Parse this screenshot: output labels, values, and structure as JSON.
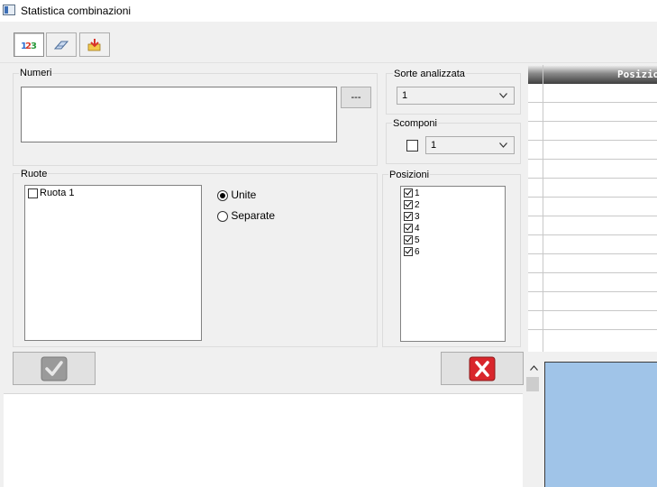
{
  "window": {
    "title": "Statistica combinazioni"
  },
  "toolbar": {
    "buttons": [
      {
        "name": "numbers-icon",
        "pressed": true
      },
      {
        "name": "eraser-icon",
        "pressed": false
      },
      {
        "name": "import-icon",
        "pressed": false
      }
    ]
  },
  "numeri": {
    "label": "Numeri",
    "value": "",
    "browse_label": "---"
  },
  "sorte": {
    "label": "Sorte analizzata",
    "selected": "1"
  },
  "scomponi": {
    "label": "Scomponi",
    "checked": false,
    "selected": "1"
  },
  "ruote": {
    "label": "Ruote",
    "items": [
      {
        "label": "Ruota 1",
        "checked": false
      }
    ],
    "modes": [
      {
        "label": "Unite",
        "selected": true
      },
      {
        "label": "Separate",
        "selected": false
      }
    ]
  },
  "posizioni": {
    "label": "Posizioni",
    "items": [
      {
        "label": "1",
        "checked": true
      },
      {
        "label": "2",
        "checked": true
      },
      {
        "label": "3",
        "checked": true
      },
      {
        "label": "4",
        "checked": true
      },
      {
        "label": "5",
        "checked": true
      },
      {
        "label": "6",
        "checked": true
      }
    ]
  },
  "actions": {
    "confirm_icon": "checkmark-icon",
    "cancel_icon": "close-icon"
  },
  "grid": {
    "header": "Posizio"
  },
  "colors": {
    "panel_blue": "#a0c4e8",
    "cancel_red": "#d9262c"
  }
}
